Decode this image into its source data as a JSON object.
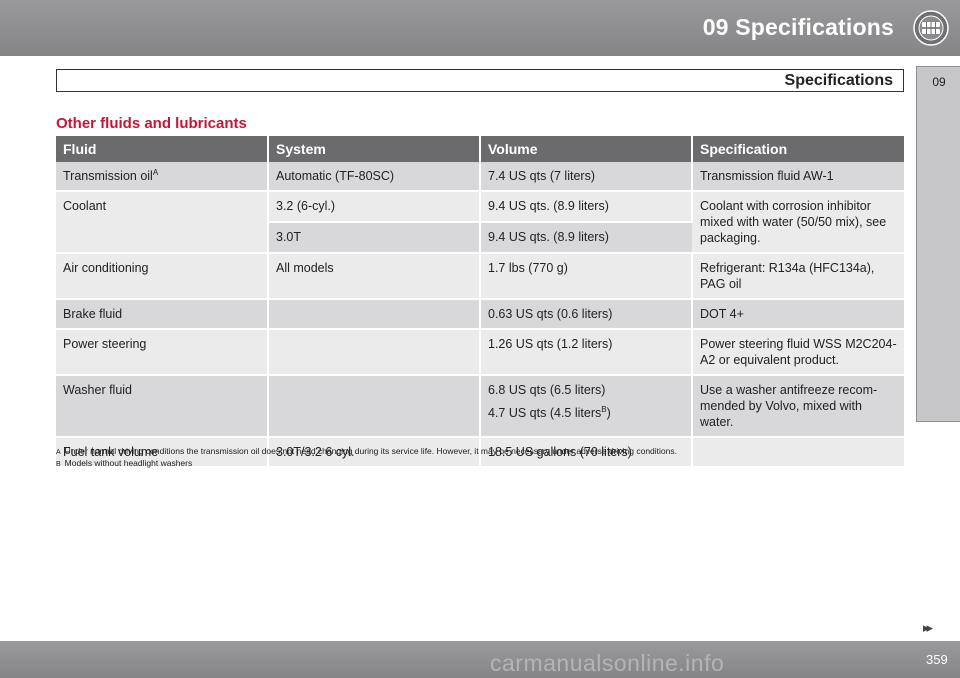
{
  "header": {
    "chapter_title": "09 Specifications",
    "chapter_icon": "specifications-dial-icon"
  },
  "sidetab": {
    "label": "09"
  },
  "section": {
    "title": "Specifications"
  },
  "heading": "Other fluids and lubricants",
  "table": {
    "columns": [
      "Fluid",
      "System",
      "Volume",
      "Specification"
    ],
    "rows": {
      "transmission": {
        "fluid": "Transmission oil",
        "fluid_note": "A",
        "system": "Automatic (TF-80SC)",
        "volume": "7.4 US qts (7 liters)",
        "spec": "Transmission fluid AW-1"
      },
      "coolant": {
        "fluid": "Coolant",
        "system_1": "3.2 (6-cyl.)",
        "volume_1": "9.4 US qts. (8.9 liters)",
        "system_2": "3.0T",
        "volume_2": "9.4 US qts. (8.9 liters)",
        "spec": "Coolant with corrosion inhibitor mixed with water (50/50 mix), see packaging."
      },
      "air_conditioning": {
        "fluid": "Air conditioning",
        "system": "All models",
        "volume": "1.7 lbs (770 g)",
        "spec": "Refrigerant: R134a (HFC134a), PAG oil"
      },
      "brake_fluid": {
        "fluid": "Brake fluid",
        "system": "",
        "volume": "0.63 US qts (0.6 liters)",
        "spec": "DOT 4+"
      },
      "power_steering": {
        "fluid": "Power steering",
        "system": "",
        "volume": "1.26 US qts (1.2 liters)",
        "spec": "Power steering fluid WSS M2C204-A2 or equivalent product."
      },
      "washer_fluid": {
        "fluid": "Washer fluid",
        "system": "",
        "volume_1": "6.8 US qts (6.5 liters)",
        "volume_2": "4.7 US qts (4.5 liters",
        "volume_2_note": "B",
        "volume_2_end": ")",
        "spec": "Use a washer antifreeze recom-mended by Volvo, mixed with water."
      },
      "fuel_tank": {
        "fluid": "Fuel tank volume",
        "system": "3.0T/3.2 6 cyl.",
        "volume": "18.5 US gallons (70 liters)",
        "spec": ""
      }
    }
  },
  "footnotes": [
    {
      "letter": "A",
      "text": "Under normal driving conditions the transmission oil does not need changing during its service life. However, it may be necessary under adverse driving conditions."
    },
    {
      "letter": "B",
      "text": "Models without headlight washers"
    }
  ],
  "footer": {
    "next_arrows": "▸▸",
    "page_number": "359",
    "watermark": "carmanualsonline.info"
  }
}
